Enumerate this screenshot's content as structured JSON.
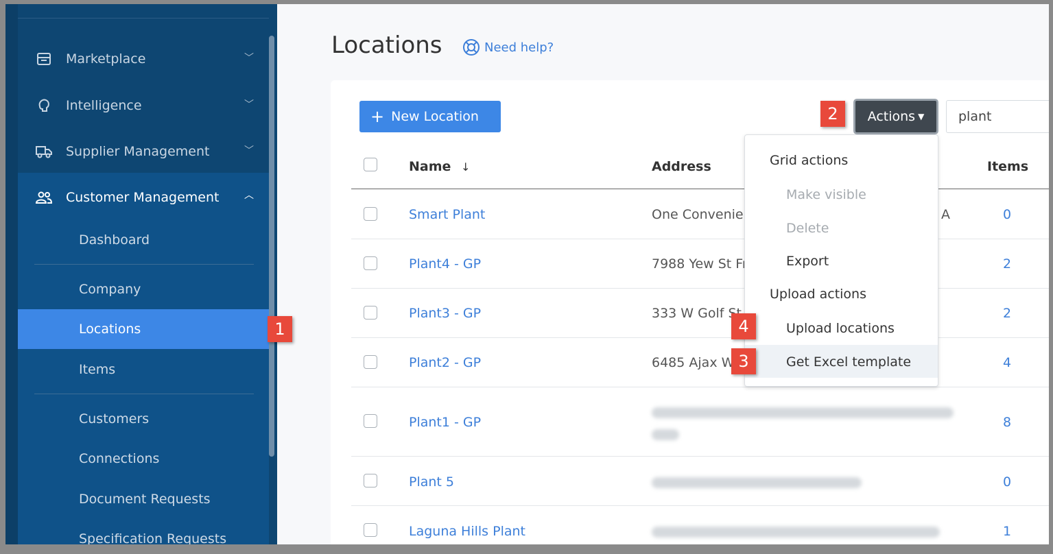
{
  "sidebar": {
    "nav": [
      {
        "label": "Marketplace",
        "icon": "store-icon"
      },
      {
        "label": "Intelligence",
        "icon": "brain-icon"
      },
      {
        "label": "Supplier Management",
        "icon": "truck-icon"
      },
      {
        "label": "Customer Management",
        "icon": "users-icon"
      }
    ],
    "sub": [
      "Dashboard",
      "Company",
      "Locations",
      "Items",
      "Customers",
      "Connections",
      "Document Requests",
      "Specification Requests"
    ]
  },
  "page": {
    "title": "Locations",
    "help": "Need help?"
  },
  "toolbar": {
    "new_label": "New Location",
    "actions_label": "Actions",
    "search_value": "plant"
  },
  "table": {
    "headers": {
      "name": "Name",
      "sort": "↓",
      "address": "Address",
      "items": "Items"
    },
    "rows": [
      {
        "name": "Smart Plant",
        "address": "One Convenie",
        "address_tail": "A",
        "items": "0"
      },
      {
        "name": "Plant4 - GP",
        "address": "7988 Yew St Fr",
        "items": "2"
      },
      {
        "name": "Plant3 - GP",
        "address": "333 W Golf St",
        "items": "2"
      },
      {
        "name": "Plant2 - GP",
        "address": "6485 Ajax W",
        "items": "4"
      },
      {
        "name": "Plant1 - GP",
        "address": "",
        "items": "8"
      },
      {
        "name": "Plant 5",
        "address": "",
        "items": "0"
      },
      {
        "name": "Laguna Hills Plant",
        "address": "",
        "items": "1"
      }
    ]
  },
  "dropdown": {
    "grid_header": "Grid actions",
    "make_visible": "Make visible",
    "delete": "Delete",
    "export": "Export",
    "upload_header": "Upload actions",
    "upload_locations": "Upload locations",
    "excel_template": "Get Excel template"
  },
  "badges": {
    "b1": "1",
    "b2": "2",
    "b3": "3",
    "b4": "4"
  },
  "colors": {
    "sidebar": "#0e4672",
    "accent": "#3d87e6",
    "badge": "#e8493b",
    "link": "#3d7fd9"
  }
}
